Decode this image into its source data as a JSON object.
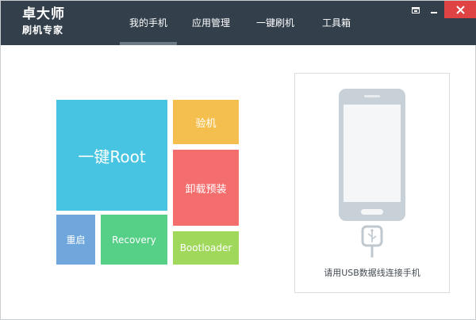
{
  "app": {
    "logo_line1": "卓大师",
    "logo_line2": "刷机专家"
  },
  "nav": {
    "tabs": [
      {
        "label": "我的手机",
        "active": true
      },
      {
        "label": "应用管理",
        "active": false
      },
      {
        "label": "一键刷机",
        "active": false
      },
      {
        "label": "工具箱",
        "active": false
      }
    ]
  },
  "window_controls": {
    "icons": [
      "restore-icon",
      "minimize-icon",
      "close-icon"
    ]
  },
  "tiles": {
    "root": "一键Root",
    "verify": "验机",
    "uninstall": "卸载预装",
    "restart": "重启",
    "recovery": "Recovery",
    "bootloader": "Bootloader"
  },
  "connect_panel": {
    "hint": "请用USB数据线连接手机"
  },
  "colors": {
    "header_bg": "#33404c",
    "tab_indicator": "#6c7a86",
    "close_bg": "#e04343",
    "root": "#47c4e1",
    "verify": "#f4bf4e",
    "uninstall": "#f56e6e",
    "restart": "#6fa7dd",
    "recovery": "#56cf87",
    "bootloader": "#a0d85b",
    "phone_outline": "#c9d1d8"
  }
}
